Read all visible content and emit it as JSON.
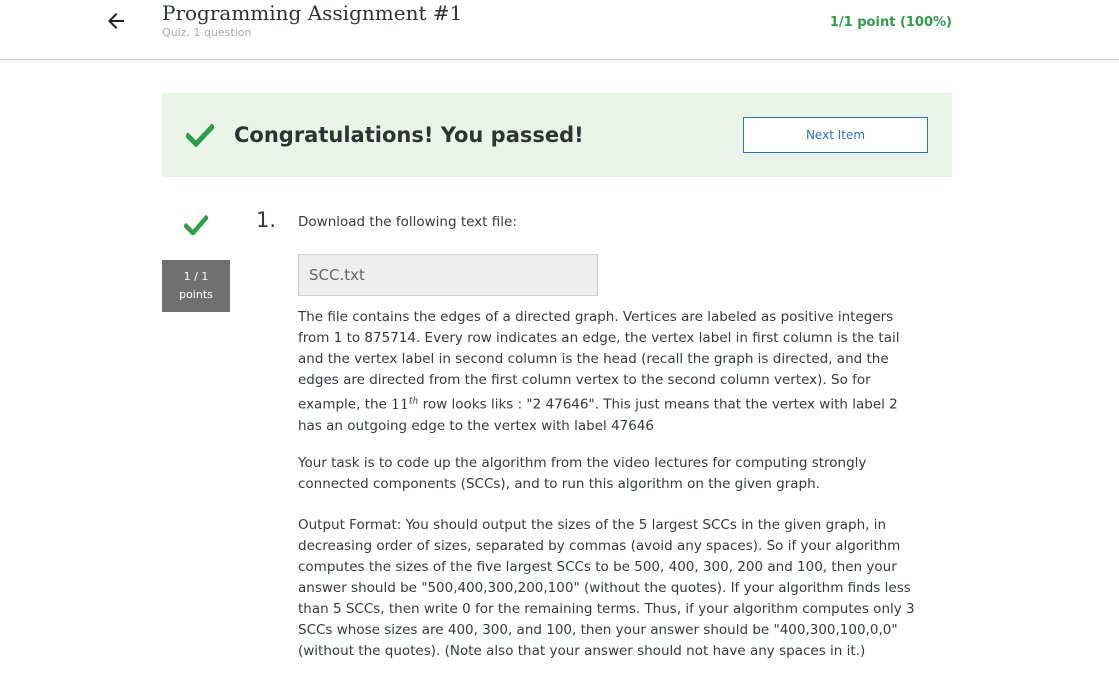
{
  "header": {
    "title": "Programming Assignment #1",
    "subtitle": "Quiz, 1 question",
    "score": "1/1 point (100%)"
  },
  "banner": {
    "message": "Congratulations! You passed!",
    "next_button": "Next Item"
  },
  "question": {
    "number": "1.",
    "points_line1": "1 / 1",
    "points_line2": "points",
    "prompt": "Download the following text file:",
    "file_name": "SCC.txt",
    "paragraph1_part1": "The file contains the edges of a directed graph. Vertices are labeled as positive integers from 1 to 875714. Every row indicates an edge, the vertex label in first column is the tail and the vertex label in second column is the head (recall the graph is directed, and the edges are directed from the first column vertex to the second column vertex). So for example, the ",
    "paragraph1_math": "11",
    "paragraph1_math_sup": "th",
    "paragraph1_part2": " row looks liks : \"2 47646\". This just means that the vertex with label 2 has an outgoing edge to the vertex with label 47646",
    "paragraph2": "Your task is to code up the algorithm from the video lectures for computing strongly connected components (SCCs), and to run this algorithm on the given graph.",
    "paragraph3": "Output Format: You should output the sizes of the 5 largest SCCs in the given graph, in decreasing order of sizes, separated by commas (avoid any spaces). So if your algorithm computes the sizes of the five largest SCCs to be 500, 400, 300, 200 and 100, then your answer should be \"500,400,300,200,100\" (without the quotes). If your algorithm finds less than 5 SCCs, then write 0 for the remaining terms. Thus, if your algorithm computes only 3 SCCs whose sizes are 400, 300, and 100, then your answer should be \"400,300,100,0,0\" (without the quotes). (Note also that your answer should not have any spaces in it.)"
  },
  "icons": {
    "back": "arrow-left-icon",
    "banner_check": "checkmark-icon",
    "question_check": "checkmark-icon"
  },
  "colors": {
    "success_green": "#2c9e48",
    "banner_bg": "#eaf3e7",
    "link_blue": "#2a73cc",
    "points_bg": "#707070"
  }
}
